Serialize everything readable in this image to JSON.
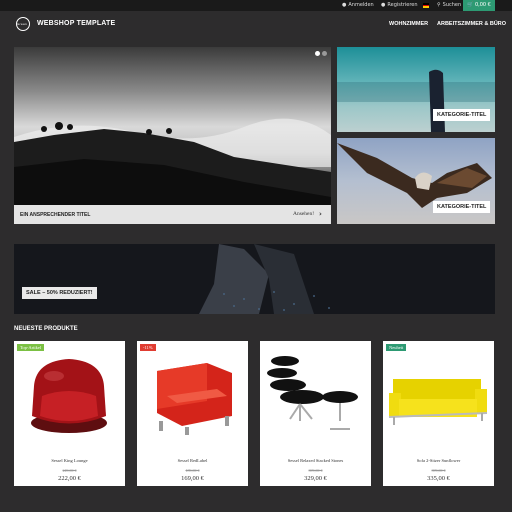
{
  "topbar": {
    "login": "Anmelden",
    "register": "Registrieren",
    "search": "Suchen",
    "cart": "0,00 €"
  },
  "header": {
    "logo_text": "Green",
    "brand": "WEBSHOP TEMPLATE",
    "nav": [
      "WOHNZIMMER",
      "ARBEITSZIMMER & BÜRO"
    ]
  },
  "hero": {
    "title": "EIN ANSPRECHENDER TITEL",
    "link": "Ansehen!",
    "arrow": "›"
  },
  "tiles": [
    {
      "label": "KATEGORIE-TITEL"
    },
    {
      "label": "KATEGORIE-TITEL"
    }
  ],
  "sale": {
    "label": "SALE – 50% REDUZIERT!"
  },
  "products_section": {
    "title": "NEUESTE PRODUKTE"
  },
  "products": [
    {
      "badge": "Top-Artikel",
      "badge_color": "#7bc043",
      "name": "Sessel King Lounge",
      "old_price": "249,00 €",
      "price": "222,00 €"
    },
    {
      "badge": "-11%",
      "badge_color": "#e03c31",
      "name": "Sessel RedLabel",
      "old_price": "189,00 €",
      "price": "169,00 €"
    },
    {
      "badge": "",
      "badge_color": "",
      "name": "Sessel Relaxed Stacked Stones",
      "old_price": "399,00 €",
      "price": "329,00 €"
    },
    {
      "badge": "Neuheit",
      "badge_color": "#2d9a73",
      "name": "Sofa 2-Sitzer Sunflower",
      "old_price": "399,00 €",
      "price": "335,00 €"
    }
  ],
  "colors": {
    "accent": "#2d9a73",
    "page_bg": "#2d2c2d"
  }
}
